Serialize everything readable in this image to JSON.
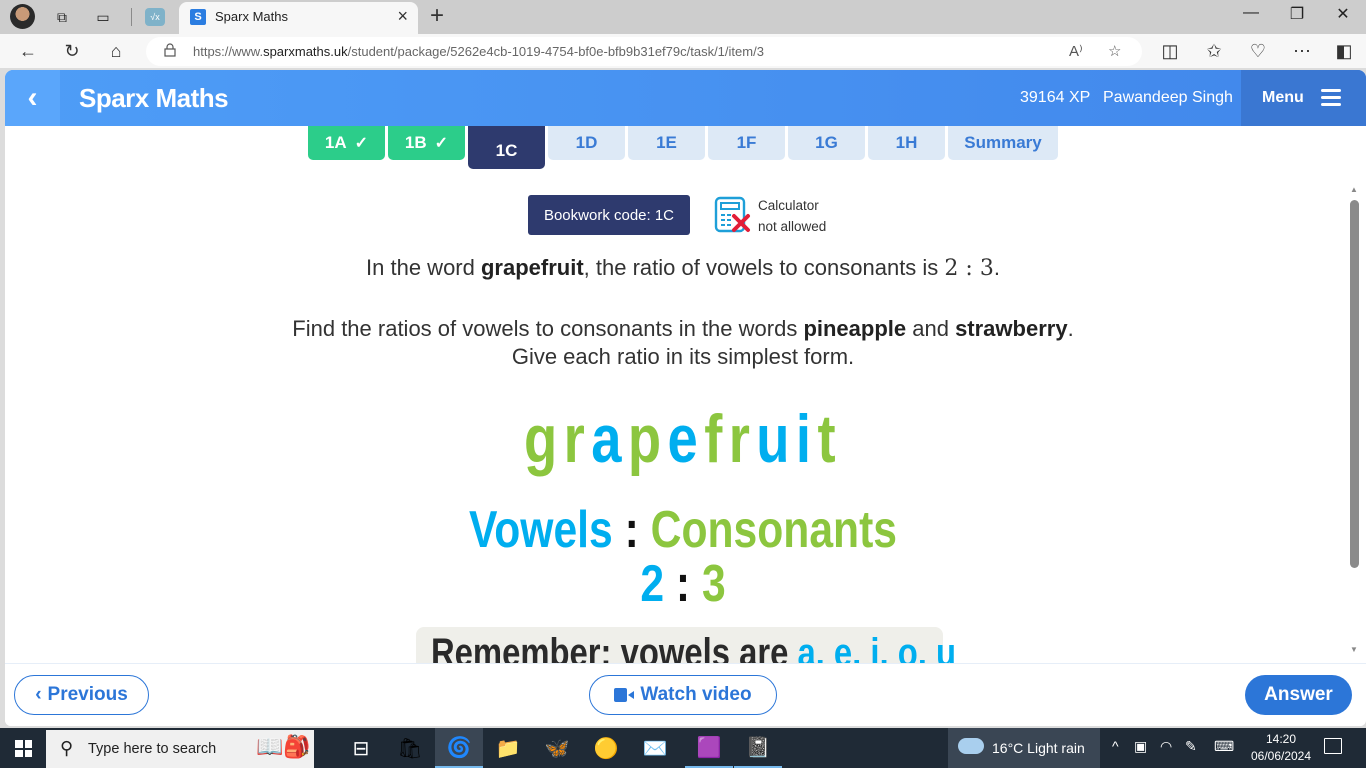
{
  "browser": {
    "tab_title": "Sparx Maths",
    "favicon_letter": "S",
    "pinned_tab_label": "√x",
    "url_prefix": "https://www.",
    "url_domain": "sparxmaths.uk",
    "url_path": "/student/package/5262e4cb-1019-4754-bf0e-bfb9b31ef79c/task/1/item/3",
    "icons": [
      "back-arrow",
      "refresh",
      "home",
      "lock",
      "read-aloud",
      "favorite-star",
      "split-screen",
      "favorites",
      "browser-essentials",
      "more",
      "sidebar"
    ]
  },
  "header": {
    "brand": "Sparx Maths",
    "xp": "39164 XP",
    "user": "Pawandeep Singh",
    "menu_label": "Menu"
  },
  "tasks": [
    {
      "label": "1A",
      "state": "done"
    },
    {
      "label": "1B",
      "state": "done"
    },
    {
      "label": "1C",
      "state": "current"
    },
    {
      "label": "1D",
      "state": "todo"
    },
    {
      "label": "1E",
      "state": "todo"
    },
    {
      "label": "1F",
      "state": "todo"
    },
    {
      "label": "1G",
      "state": "todo"
    },
    {
      "label": "1H",
      "state": "todo"
    },
    {
      "label": "Summary",
      "state": "todo"
    }
  ],
  "question": {
    "bookwork_code": "Bookwork code: 1C",
    "calculator_line1": "Calculator",
    "calculator_line2": "not allowed",
    "q1_prefix": "In the word ",
    "q1_word": "grapefruit",
    "q1_middle": ", the ratio of vowels to consonants is ",
    "q1_ratio": "2 : 3",
    "q1_suffix": ".",
    "q2_prefix": "Find the ratios of vowels to consonants in the words ",
    "q2_word1": "pineapple",
    "q2_and": " and ",
    "q2_word2": "strawberry",
    "q2_suffix": ".",
    "q3": "Give each ratio in its simplest form."
  },
  "illustration": {
    "letters": [
      {
        "ch": "g",
        "type": "consonant"
      },
      {
        "ch": "r",
        "type": "consonant"
      },
      {
        "ch": "a",
        "type": "vowel"
      },
      {
        "ch": "p",
        "type": "consonant"
      },
      {
        "ch": "e",
        "type": "vowel"
      },
      {
        "ch": "f",
        "type": "consonant"
      },
      {
        "ch": "r",
        "type": "consonant"
      },
      {
        "ch": "u",
        "type": "vowel"
      },
      {
        "ch": "i",
        "type": "vowel"
      },
      {
        "ch": "t",
        "type": "consonant"
      }
    ],
    "vowels_label": "Vowels",
    "consonants_label": "Consonants",
    "colon": ":",
    "vowel_count": "2",
    "consonant_count": "3",
    "remember_prefix": "Remember: vowels are ",
    "remember_vowels": "a, e, i, o, u",
    "colors": {
      "vowel": "#00aeef",
      "consonant": "#8cc63f"
    }
  },
  "footer": {
    "previous": "Previous",
    "watch_video": "Watch video",
    "answer": "Answer"
  },
  "taskbar": {
    "search_placeholder": "Type here to search",
    "weather": "16°C  Light rain",
    "time": "14:20",
    "date": "06/06/2024"
  },
  "colors": {
    "header_blue": "#4187eb",
    "done_green": "#2ccd8a",
    "current_navy": "#2e3a6e",
    "action_blue": "#2c76d8"
  }
}
